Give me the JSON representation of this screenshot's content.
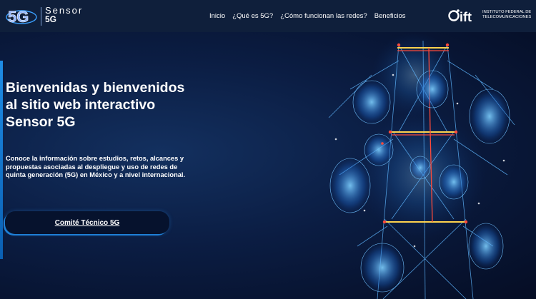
{
  "header": {
    "logo_mark": "5G",
    "logo_line1": "Sensor",
    "logo_line2": "5G",
    "nav": [
      {
        "label": "Inicio"
      },
      {
        "label": "¿Qué es 5G?"
      },
      {
        "label": "¿Cómo funcionan las redes?"
      },
      {
        "label": "Beneficios"
      }
    ],
    "ift_mark": "ift",
    "ift_line1": "INSTITUTO FEDERAL DE",
    "ift_line2": "TELECOMUNICACIONES"
  },
  "hero": {
    "title_line1": "Bienvenidas y bienvenidos",
    "title_line2": "al sitio web interactivo",
    "title_line3": "Sensor 5G",
    "description": "Conoce la información sobre estudios, retos, alcances y propuestas asociadas al despliegue y uso de redes de quinta generación (5G) en México y a nivel internacional.",
    "cta_label": "Comité Técnico 5G"
  },
  "colors": {
    "topbar": "#0f1f3b",
    "accent": "#1e7fd6",
    "hero_dark": "#050d24"
  },
  "icons": {
    "logo": "sensor-5g-logo",
    "ift": "ift-logo",
    "hero_image": "5g-tower-network-illustration"
  }
}
